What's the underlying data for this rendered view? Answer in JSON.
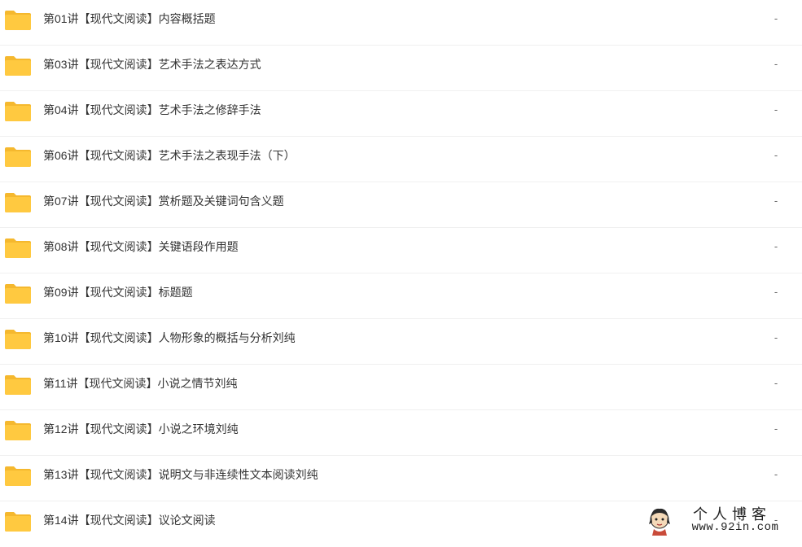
{
  "files": [
    {
      "name": "第01讲【现代文阅读】内容概括题",
      "size": "-"
    },
    {
      "name": "第03讲【现代文阅读】艺术手法之表达方式",
      "size": "-"
    },
    {
      "name": "第04讲【现代文阅读】艺术手法之修辞手法",
      "size": "-"
    },
    {
      "name": "第06讲【现代文阅读】艺术手法之表现手法（下）",
      "size": "-"
    },
    {
      "name": "第07讲【现代文阅读】赏析题及关键词句含义题",
      "size": "-"
    },
    {
      "name": "第08讲【现代文阅读】关键语段作用题",
      "size": "-"
    },
    {
      "name": "第09讲【现代文阅读】标题题",
      "size": "-"
    },
    {
      "name": "第10讲【现代文阅读】人物形象的概括与分析刘纯",
      "size": "-"
    },
    {
      "name": "第11讲【现代文阅读】小说之情节刘纯",
      "size": "-"
    },
    {
      "name": "第12讲【现代文阅读】小说之环境刘纯",
      "size": "-"
    },
    {
      "name": "第13讲【现代文阅读】说明文与非连续性文本阅读刘纯",
      "size": "-"
    },
    {
      "name": "第14讲【现代文阅读】议论文阅读",
      "size": "-"
    }
  ],
  "icons": {
    "row": "folder-icon"
  },
  "colors": {
    "folder": "#FFC940",
    "folder_tab": "#F5B82E",
    "text": "#333333"
  },
  "watermark": {
    "title": "个人博客",
    "url": "www.92in.com"
  }
}
